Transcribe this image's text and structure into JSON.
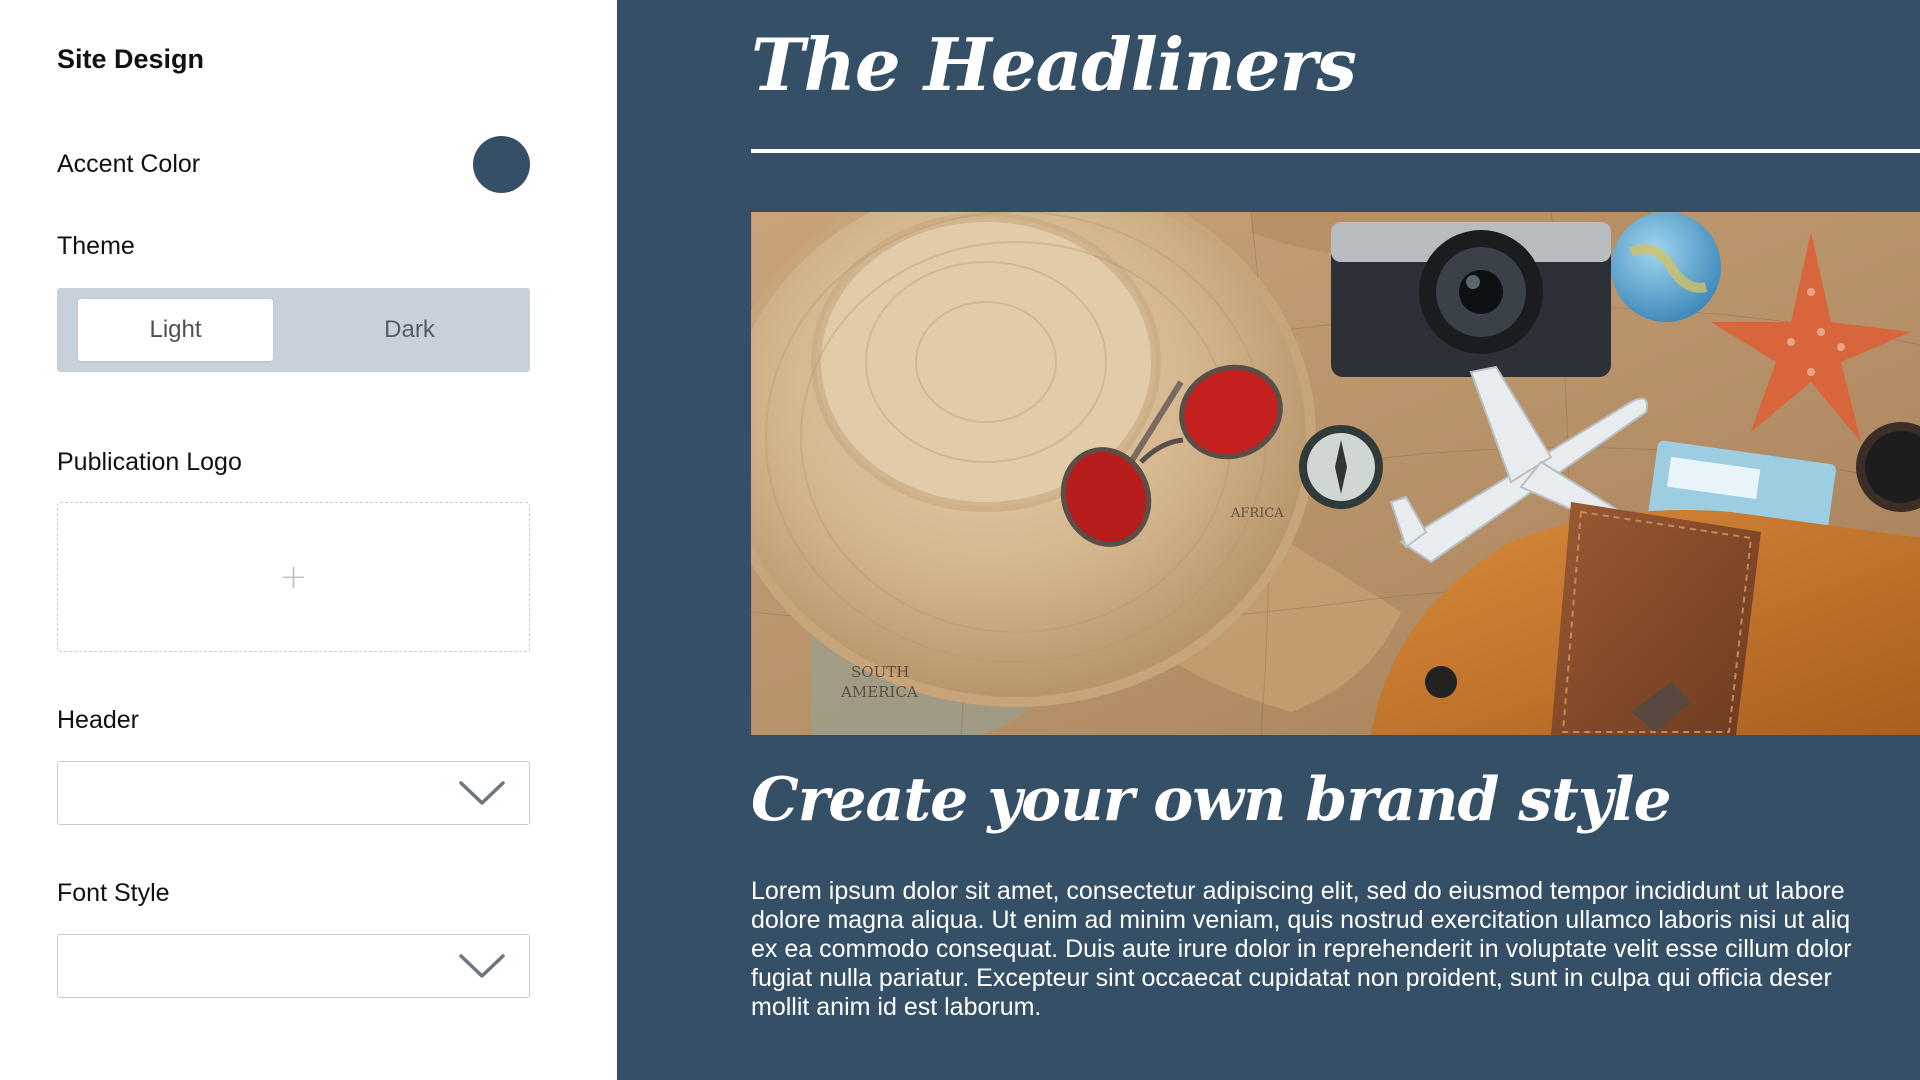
{
  "panel": {
    "title": "Site Design",
    "accent_label": "Accent Color",
    "accent_color": "#344f66",
    "theme_label": "Theme",
    "theme_options": [
      "Light",
      "Dark"
    ],
    "theme_selected": "Light",
    "logo_label": "Publication Logo",
    "logo_placeholder_icon": "plus-icon",
    "header_label": "Header",
    "header_value": "",
    "font_label": "Font Style",
    "font_value": ""
  },
  "preview": {
    "publication_title": "The Headliners",
    "hero_image": "travel-flatlay-photo",
    "headline": "Create your own brand style",
    "body_lines": [
      "Lorem ipsum dolor sit amet, consectetur adipiscing elit, sed do eiusmod tempor incididunt ut labore",
      "dolore magna aliqua. Ut enim ad minim veniam, quis nostrud exercitation ullamco laboris nisi ut aliq",
      "ex ea commodo consequat. Duis aute irure dolor in reprehenderit in voluptate velit esse cillum dolor",
      "fugiat nulla pariatur. Excepteur sint occaecat cupidatat non proident, sunt in culpa qui officia deser",
      "mollit anim id est laborum."
    ]
  }
}
